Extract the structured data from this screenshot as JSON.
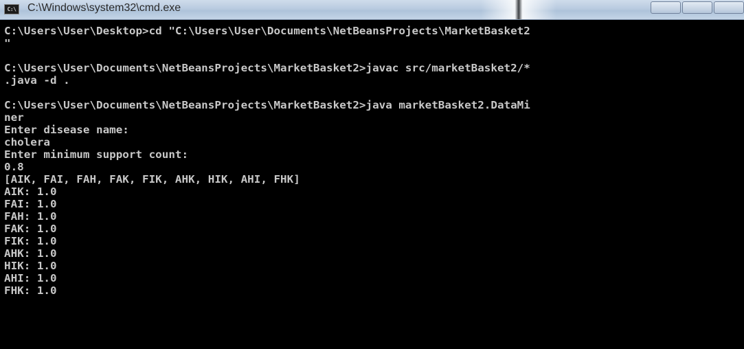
{
  "window": {
    "title": "C:\\Windows\\system32\\cmd.exe",
    "icon_name": "cmd-icon",
    "icon_text": "C:\\"
  },
  "console": {
    "lines": [
      "C:\\Users\\User\\Desktop>cd \"C:\\Users\\User\\Documents\\NetBeansProjects\\MarketBasket2",
      "\"",
      "",
      "C:\\Users\\User\\Documents\\NetBeansProjects\\MarketBasket2>javac src/marketBasket2/*",
      ".java -d .",
      "",
      "C:\\Users\\User\\Documents\\NetBeansProjects\\MarketBasket2>java marketBasket2.DataMi",
      "ner",
      "Enter disease name:",
      "cholera",
      "Enter minimum support count:",
      "0.8",
      "[AIK, FAI, FAH, FAK, FIK, AHK, HIK, AHI, FHK]",
      "AIK: 1.0",
      "FAI: 1.0",
      "FAH: 1.0",
      "FAK: 1.0",
      "FIK: 1.0",
      "AHK: 1.0",
      "HIK: 1.0",
      "AHI: 1.0",
      "FHK: 1.0"
    ]
  },
  "colors": {
    "console_bg": "#000000",
    "console_text": "#c8c8c8"
  }
}
